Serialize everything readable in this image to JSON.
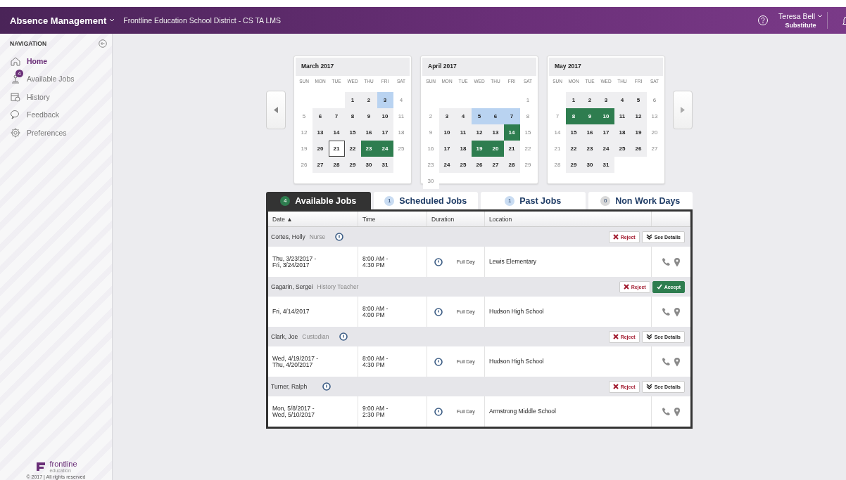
{
  "header": {
    "app": "Absence Management",
    "district": "Frontline Education School District - CS TA LMS",
    "user": "Teresa Bell",
    "role": "Substitute"
  },
  "sidebar": {
    "title": "NAVIGATION",
    "items": [
      {
        "label": "Home",
        "selected": true
      },
      {
        "label": "Available Jobs",
        "selected": false,
        "badge": "4"
      },
      {
        "label": "History",
        "selected": false
      },
      {
        "label": "Feedback",
        "selected": false
      },
      {
        "label": "Preferences",
        "selected": false
      }
    ],
    "logo": "frontline",
    "logo_sub": "education",
    "copyright": "© 2017 | All rights reserved"
  },
  "calendar": {
    "months": [
      {
        "title": "March 2017",
        "weekdays": [
          "SUN",
          "MON",
          "TUE",
          "WED",
          "THU",
          "FRI",
          "SAT"
        ],
        "weeks": [
          {
            "kind": "first",
            "days": [
              {
                "day": "1",
                "color": "#efeff1",
                "today": false
              },
              {
                "day": "2",
                "color": "#efeff1",
                "today": false
              },
              {
                "day": "3",
                "color": "#b9d3f1",
                "today": false
              },
              {
                "day": "4",
                "color": "#ffffff",
                "today": false
              }
            ]
          },
          {
            "kind": "full",
            "days": [
              {
                "day": "5",
                "color": "#ffffff",
                "today": false
              },
              {
                "day": "6",
                "color": "#efeff1",
                "today": false
              },
              {
                "day": "7",
                "color": "#efeff1",
                "today": false
              },
              {
                "day": "8",
                "color": "#efeff1",
                "today": false
              },
              {
                "day": "9",
                "color": "#efeff1",
                "today": false
              },
              {
                "day": "10",
                "color": "#efeff1",
                "today": false
              },
              {
                "day": "11",
                "color": "#ffffff",
                "today": false
              }
            ]
          },
          {
            "kind": "full",
            "days": [
              {
                "day": "12",
                "color": "#ffffff",
                "today": false
              },
              {
                "day": "13",
                "color": "#efeff1",
                "today": false
              },
              {
                "day": "14",
                "color": "#efeff1",
                "today": false
              },
              {
                "day": "15",
                "color": "#efeff1",
                "today": false
              },
              {
                "day": "16",
                "color": "#efeff1",
                "today": false
              },
              {
                "day": "17",
                "color": "#efeff1",
                "today": false
              },
              {
                "day": "18",
                "color": "#ffffff",
                "today": false
              }
            ]
          },
          {
            "kind": "full",
            "days": [
              {
                "day": "19",
                "color": "#ffffff",
                "today": false
              },
              {
                "day": "20",
                "color": "#efeff1",
                "today": false
              },
              {
                "day": "21",
                "color": "#ffffff",
                "today": true
              },
              {
                "day": "22",
                "color": "#efeff1",
                "today": false
              },
              {
                "day": "23",
                "color": "#2e7d4f",
                "today": false
              },
              {
                "day": "24",
                "color": "#2e7d4f",
                "today": false
              },
              {
                "day": "25",
                "color": "#ffffff",
                "today": false
              }
            ]
          },
          {
            "kind": "last",
            "days": [
              {
                "day": "26",
                "color": "#ffffff",
                "today": false
              },
              {
                "day": "27",
                "color": "#efeff1",
                "today": false
              },
              {
                "day": "28",
                "color": "#efeff1",
                "today": false
              },
              {
                "day": "29",
                "color": "#efeff1",
                "today": false
              },
              {
                "day": "30",
                "color": "#efeff1",
                "today": false
              },
              {
                "day": "31",
                "color": "#efeff1",
                "today": false
              }
            ]
          }
        ]
      },
      {
        "title": "April 2017",
        "weekdays": [
          "SUN",
          "MON",
          "TUE",
          "WED",
          "THU",
          "FRI",
          "SAT"
        ],
        "weeks": [
          {
            "kind": "first",
            "days": [
              {
                "day": "1",
                "color": "#ffffff",
                "today": false
              }
            ]
          },
          {
            "kind": "full",
            "days": [
              {
                "day": "2",
                "color": "#ffffff",
                "today": false
              },
              {
                "day": "3",
                "color": "#efeff1",
                "today": false
              },
              {
                "day": "4",
                "color": "#efeff1",
                "today": false
              },
              {
                "day": "5",
                "color": "#b9d3f1",
                "today": false
              },
              {
                "day": "6",
                "color": "#b9d3f1",
                "today": false
              },
              {
                "day": "7",
                "color": "#b9d3f1",
                "today": false
              },
              {
                "day": "8",
                "color": "#ffffff",
                "today": false
              }
            ]
          },
          {
            "kind": "full",
            "days": [
              {
                "day": "9",
                "color": "#ffffff",
                "today": false
              },
              {
                "day": "10",
                "color": "#efeff1",
                "today": false
              },
              {
                "day": "11",
                "color": "#efeff1",
                "today": false
              },
              {
                "day": "12",
                "color": "#efeff1",
                "today": false
              },
              {
                "day": "13",
                "color": "#efeff1",
                "today": false
              },
              {
                "day": "14",
                "color": "#2e7d4f",
                "today": false
              },
              {
                "day": "15",
                "color": "#ffffff",
                "today": false
              }
            ]
          },
          {
            "kind": "full",
            "days": [
              {
                "day": "16",
                "color": "#ffffff",
                "today": false
              },
              {
                "day": "17",
                "color": "#efeff1",
                "today": false
              },
              {
                "day": "18",
                "color": "#efeff1",
                "today": false
              },
              {
                "day": "19",
                "color": "#2e7d4f",
                "today": false
              },
              {
                "day": "20",
                "color": "#2e7d4f",
                "today": false
              },
              {
                "day": "21",
                "color": "#efeff1",
                "today": false
              },
              {
                "day": "22",
                "color": "#ffffff",
                "today": false
              }
            ]
          },
          {
            "kind": "full",
            "days": [
              {
                "day": "23",
                "color": "#ffffff",
                "today": false
              },
              {
                "day": "24",
                "color": "#efeff1",
                "today": false
              },
              {
                "day": "25",
                "color": "#efeff1",
                "today": false
              },
              {
                "day": "26",
                "color": "#efeff1",
                "today": false
              },
              {
                "day": "27",
                "color": "#efeff1",
                "today": false
              },
              {
                "day": "28",
                "color": "#efeff1",
                "today": false
              },
              {
                "day": "29",
                "color": "#ffffff",
                "today": false
              }
            ]
          },
          {
            "kind": "last",
            "days": [
              {
                "day": "30",
                "color": "#ffffff",
                "today": false
              }
            ]
          }
        ]
      },
      {
        "title": "May 2017",
        "weekdays": [
          "SUN",
          "MON",
          "TUE",
          "WED",
          "THU",
          "FRI",
          "SAT"
        ],
        "weeks": [
          {
            "kind": "first",
            "days": [
              {
                "day": "1",
                "color": "#efeff1",
                "today": false
              },
              {
                "day": "2",
                "color": "#efeff1",
                "today": false
              },
              {
                "day": "3",
                "color": "#efeff1",
                "today": false
              },
              {
                "day": "4",
                "color": "#efeff1",
                "today": false
              },
              {
                "day": "5",
                "color": "#efeff1",
                "today": false
              },
              {
                "day": "6",
                "color": "#ffffff",
                "today": false
              }
            ]
          },
          {
            "kind": "full",
            "days": [
              {
                "day": "7",
                "color": "#ffffff",
                "today": false
              },
              {
                "day": "8",
                "color": "#2e7d4f",
                "today": false
              },
              {
                "day": "9",
                "color": "#2e7d4f",
                "today": false
              },
              {
                "day": "10",
                "color": "#2e7d4f",
                "today": false
              },
              {
                "day": "11",
                "color": "#efeff1",
                "today": false
              },
              {
                "day": "12",
                "color": "#efeff1",
                "today": false
              },
              {
                "day": "13",
                "color": "#ffffff",
                "today": false
              }
            ]
          },
          {
            "kind": "full",
            "days": [
              {
                "day": "14",
                "color": "#ffffff",
                "today": false
              },
              {
                "day": "15",
                "color": "#efeff1",
                "today": false
              },
              {
                "day": "16",
                "color": "#efeff1",
                "today": false
              },
              {
                "day": "17",
                "color": "#efeff1",
                "today": false
              },
              {
                "day": "18",
                "color": "#efeff1",
                "today": false
              },
              {
                "day": "19",
                "color": "#efeff1",
                "today": false
              },
              {
                "day": "20",
                "color": "#ffffff",
                "today": false
              }
            ]
          },
          {
            "kind": "full",
            "days": [
              {
                "day": "21",
                "color": "#ffffff",
                "today": false
              },
              {
                "day": "22",
                "color": "#efeff1",
                "today": false
              },
              {
                "day": "23",
                "color": "#efeff1",
                "today": false
              },
              {
                "day": "24",
                "color": "#efeff1",
                "today": false
              },
              {
                "day": "25",
                "color": "#efeff1",
                "today": false
              },
              {
                "day": "26",
                "color": "#efeff1",
                "today": false
              },
              {
                "day": "27",
                "color": "#ffffff",
                "today": false
              }
            ]
          },
          {
            "kind": "last",
            "days": [
              {
                "day": "28",
                "color": "#ffffff",
                "today": false
              },
              {
                "day": "29",
                "color": "#efeff1",
                "today": false
              },
              {
                "day": "30",
                "color": "#efeff1",
                "today": false
              },
              {
                "day": "31",
                "color": "#efeff1",
                "today": false
              }
            ]
          }
        ]
      }
    ]
  },
  "tabs": [
    {
      "count": "4",
      "label": "Available Jobs",
      "selected": true,
      "color": "#2e7d4f"
    },
    {
      "count": "1",
      "label": "Scheduled Jobs",
      "selected": false,
      "color": "#c9dcf2"
    },
    {
      "count": "1",
      "label": "Past Jobs",
      "selected": false,
      "color": "#c9dcf2"
    },
    {
      "count": "0",
      "label": "Non Work Days",
      "selected": false,
      "color": "#d9d9d9"
    }
  ],
  "table": {
    "columns": [
      "Date ▲",
      "Time",
      "Duration",
      "Location"
    ],
    "jobs": [
      {
        "name": "Cortes, Holly",
        "role": "Nurse",
        "info": true,
        "actions": [
          {
            "kind": "reject",
            "label": "Reject"
          },
          {
            "kind": "details",
            "label": "See Details"
          }
        ],
        "date": [
          "Thu, 3/23/2017 -",
          "Fri, 3/24/2017"
        ],
        "time": [
          "8:00 AM -",
          "4:30 PM"
        ],
        "duration": "Full Day",
        "location": "Lewis Elementary"
      },
      {
        "name": "Gagarin, Sergei",
        "role": "History Teacher",
        "info": false,
        "actions": [
          {
            "kind": "reject",
            "label": "Reject"
          },
          {
            "kind": "accept",
            "label": "Accept"
          }
        ],
        "date": [
          "Fri, 4/14/2017"
        ],
        "time": [
          "8:00 AM -",
          "4:00 PM"
        ],
        "duration": "Full Day",
        "location": "Hudson High School"
      },
      {
        "name": "Clark, Joe",
        "role": "Custodian",
        "info": true,
        "actions": [
          {
            "kind": "reject",
            "label": "Reject"
          },
          {
            "kind": "details",
            "label": "See Details"
          }
        ],
        "date": [
          "Wed, 4/19/2017 -",
          "Thu, 4/20/2017"
        ],
        "time": [
          "8:00 AM -",
          "4:30 PM"
        ],
        "duration": "Full Day",
        "location": "Hudson High School"
      },
      {
        "name": "Turner, Ralph",
        "info": true,
        "actions": [
          {
            "kind": "reject",
            "label": "Reject"
          },
          {
            "kind": "details",
            "label": "See Details"
          }
        ],
        "date": [
          "Mon, 5/8/2017 -",
          "Wed, 5/10/2017"
        ],
        "time": [
          "9:00 AM -",
          "2:30 PM"
        ],
        "duration": "Full Day",
        "location": "Armstrong Middle School"
      }
    ]
  }
}
